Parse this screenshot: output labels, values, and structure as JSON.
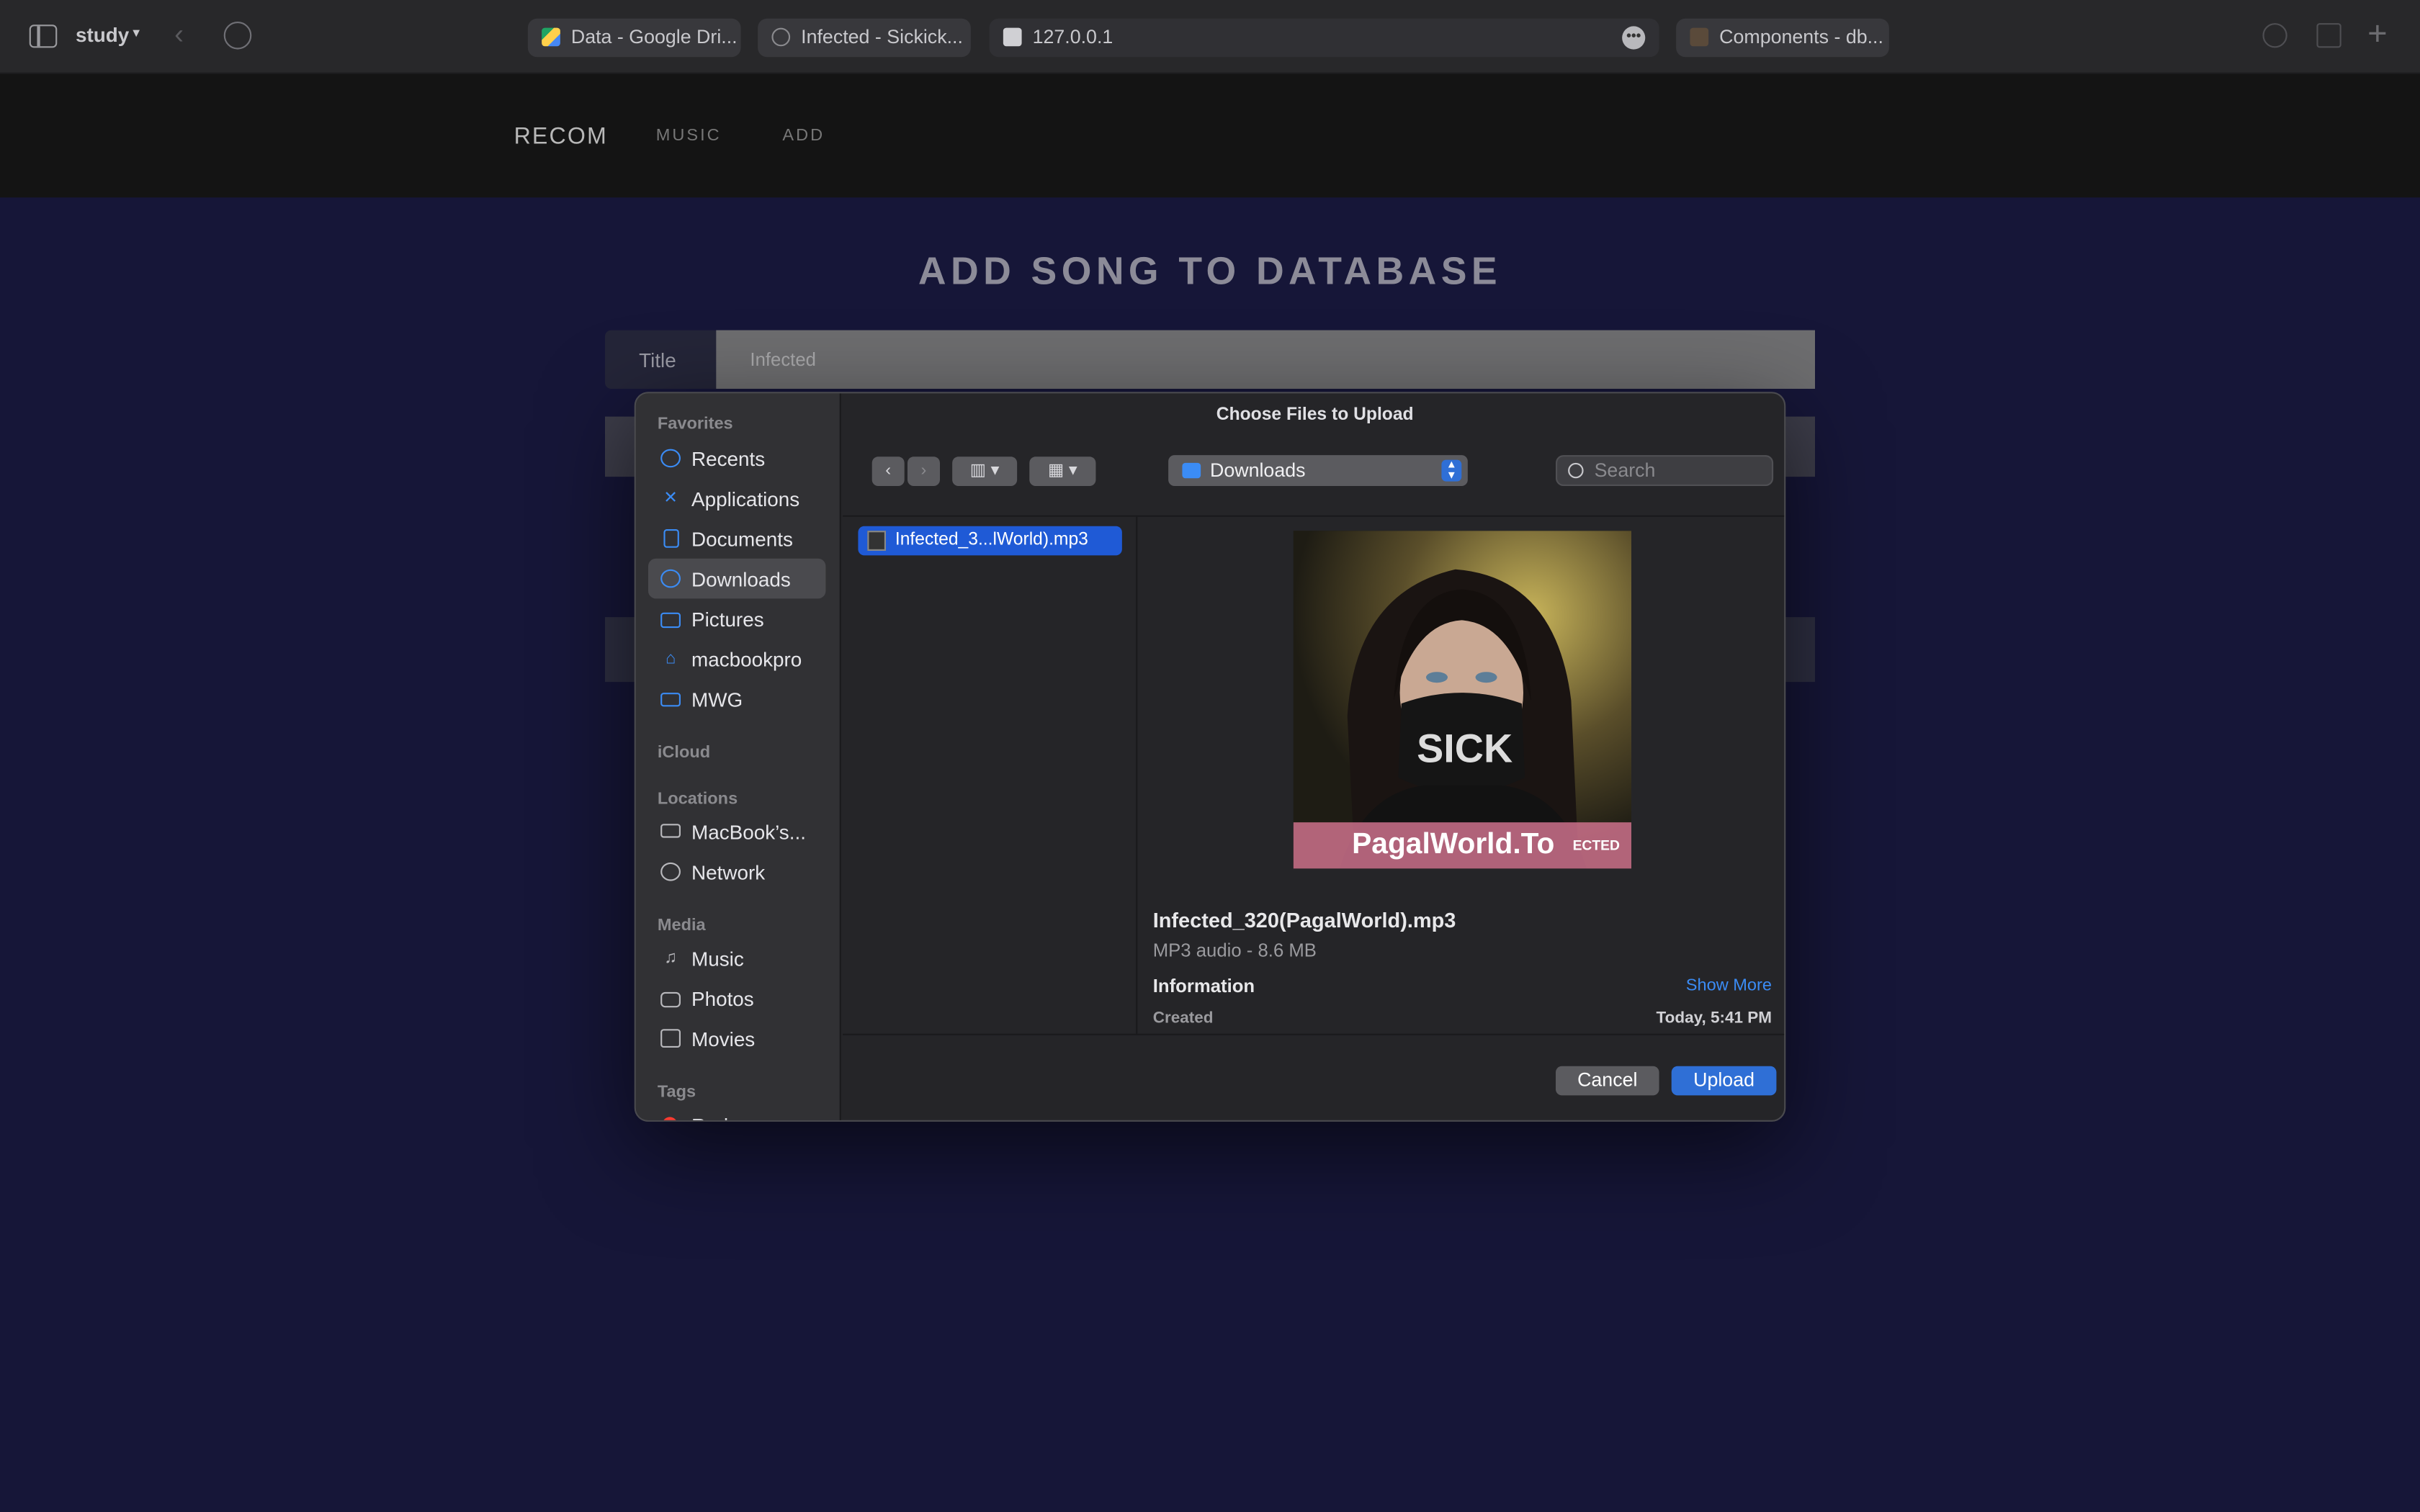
{
  "browser": {
    "profile": "study",
    "tabs": [
      {
        "label": "Data - Google Dri..."
      },
      {
        "label": "Infected - Sickick..."
      },
      {
        "label": "127.0.0.1"
      },
      {
        "label": "Components - db..."
      }
    ]
  },
  "appnav": {
    "brand": "RECOM",
    "links": [
      "MUSIC",
      "ADD"
    ]
  },
  "page": {
    "title": "ADD SONG TO DATABASE",
    "title_field": {
      "label": "Title",
      "value": "Infected"
    }
  },
  "dialog": {
    "title": "Choose Files to Upload",
    "sidebar": {
      "favorites_header": "Favorites",
      "favorites": [
        "Recents",
        "Applications",
        "Documents",
        "Downloads",
        "Pictures",
        "macbookpro",
        "MWG"
      ],
      "icloud_header": "iCloud",
      "locations_header": "Locations",
      "locations": [
        "MacBook’s...",
        "Network"
      ],
      "media_header": "Media",
      "media": [
        "Music",
        "Photos",
        "Movies"
      ],
      "tags_header": "Tags",
      "tags_partial": "Red"
    },
    "location": "Downloads",
    "search_placeholder": "Search",
    "file_row": "Infected_3...lWorld).mp3",
    "preview": {
      "watermark": "PagalWorld.To",
      "watermark_cut": "ECTED",
      "filename": "Infected_320(PagalWorld).mp3",
      "meta": "MP3 audio - 8.6 MB",
      "info_header": "Information",
      "show_more": "Show More",
      "created_label": "Created",
      "created_value": "Today, 5:41 PM"
    },
    "cancel": "Cancel",
    "upload": "Upload"
  }
}
